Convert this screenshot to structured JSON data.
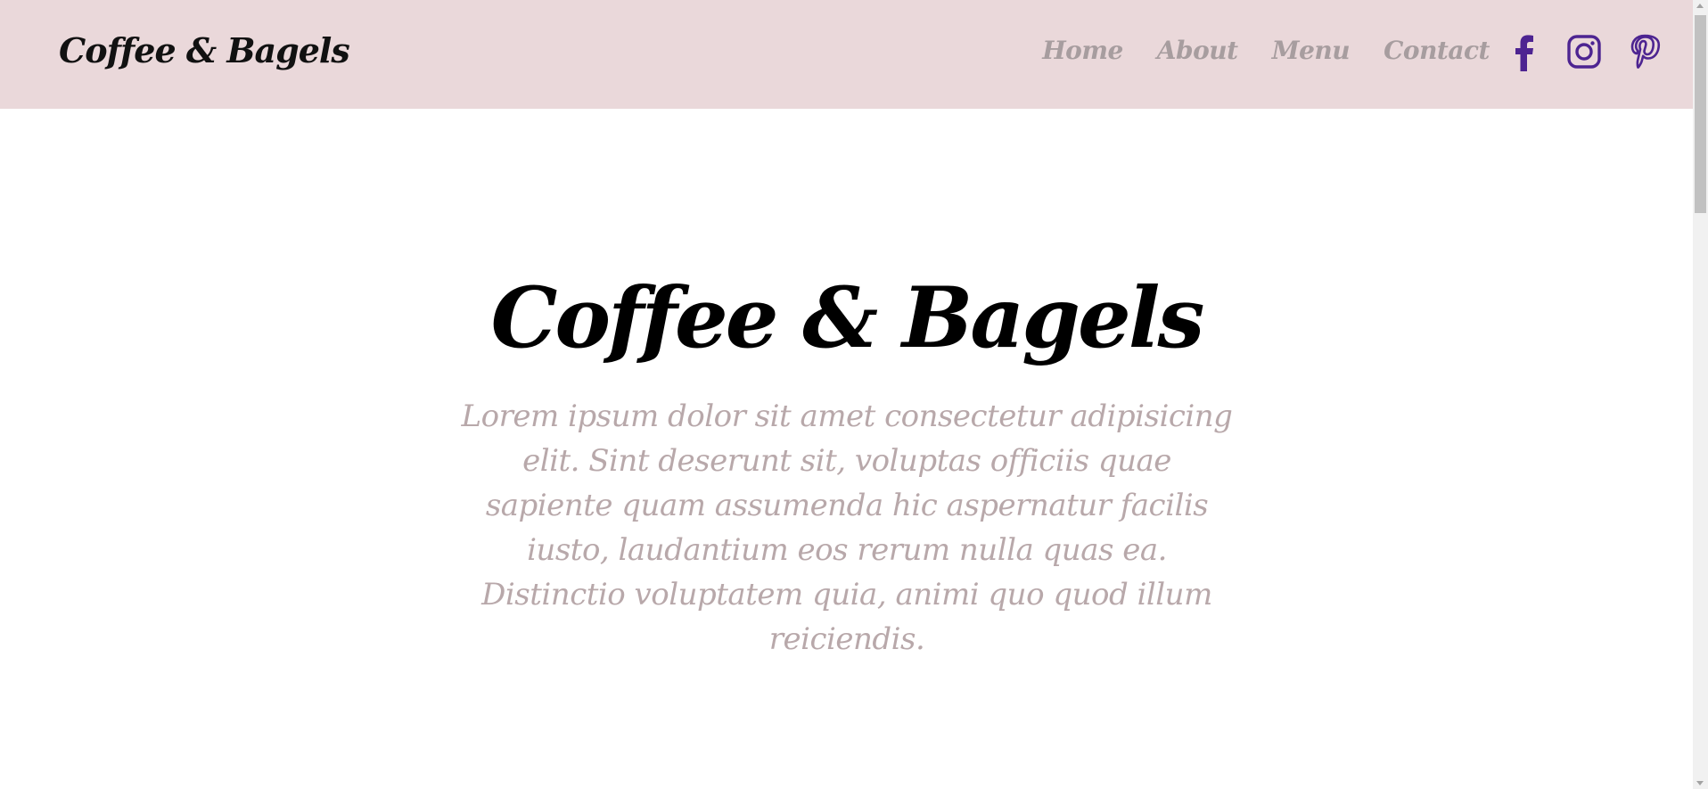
{
  "navbar": {
    "brand": "Coffee & Bagels",
    "links": [
      {
        "label": "Home"
      },
      {
        "label": "About"
      },
      {
        "label": "Menu"
      },
      {
        "label": "Contact"
      }
    ],
    "socials": [
      {
        "name": "facebook-icon"
      },
      {
        "name": "instagram-icon"
      },
      {
        "name": "pinterest-icon"
      }
    ]
  },
  "hero": {
    "title": "Coffee & Bagels",
    "text": "Lorem ipsum dolor sit amet consectetur adipisicing elit. Sint deserunt sit, voluptas officiis quae sapiente quam assumenda hic aspernatur facilis iusto, laudantium eos rerum nulla quas ea. Distinctio voluptatem quia, animi quo quod illum reiciendis."
  },
  "colors": {
    "navbar_bg": "#ead8da",
    "nav_link": "#a79d9f",
    "social_icon": "#4d2491",
    "hero_text": "#b8a8aa",
    "title": "#000000"
  }
}
